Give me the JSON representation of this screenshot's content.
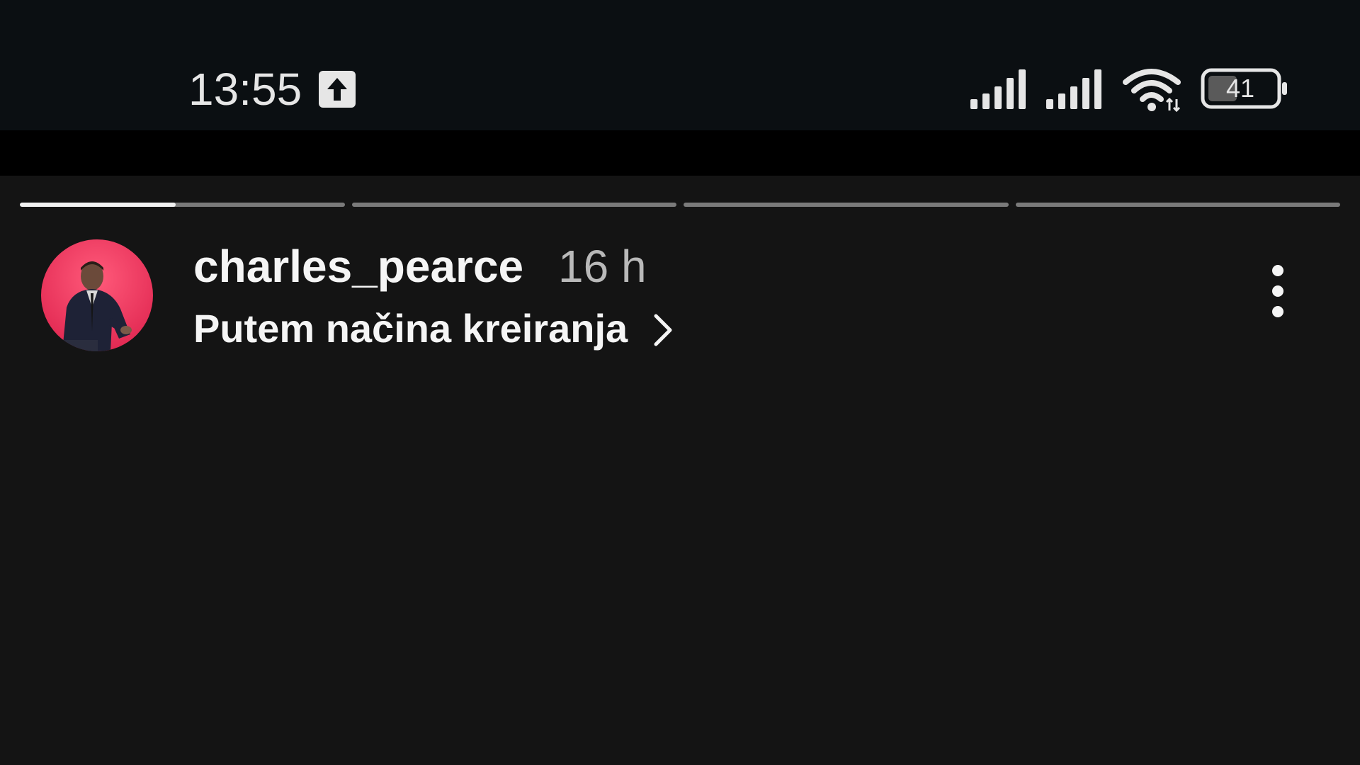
{
  "status_bar": {
    "time": "13:55",
    "battery_level": "41",
    "icons": [
      "upload-icon",
      "signal-icon",
      "signal-icon",
      "wifi-icon",
      "battery-icon"
    ]
  },
  "story": {
    "segment_count": 4,
    "current_segment_progress": 0.48,
    "username": "charles_pearce",
    "timestamp": "16 h",
    "subtitle": "Putem načina kreiranja"
  },
  "colors": {
    "status_bar_bg": "#0b0f12",
    "band_bg": "#000000",
    "background": "#141414",
    "text_primary": "#f5f5f5",
    "text_secondary": "#b9b9b9",
    "progress_track": "#7a7a7a",
    "progress_fill": "#f2f2f2",
    "avatar_bg": "#e8345f"
  }
}
